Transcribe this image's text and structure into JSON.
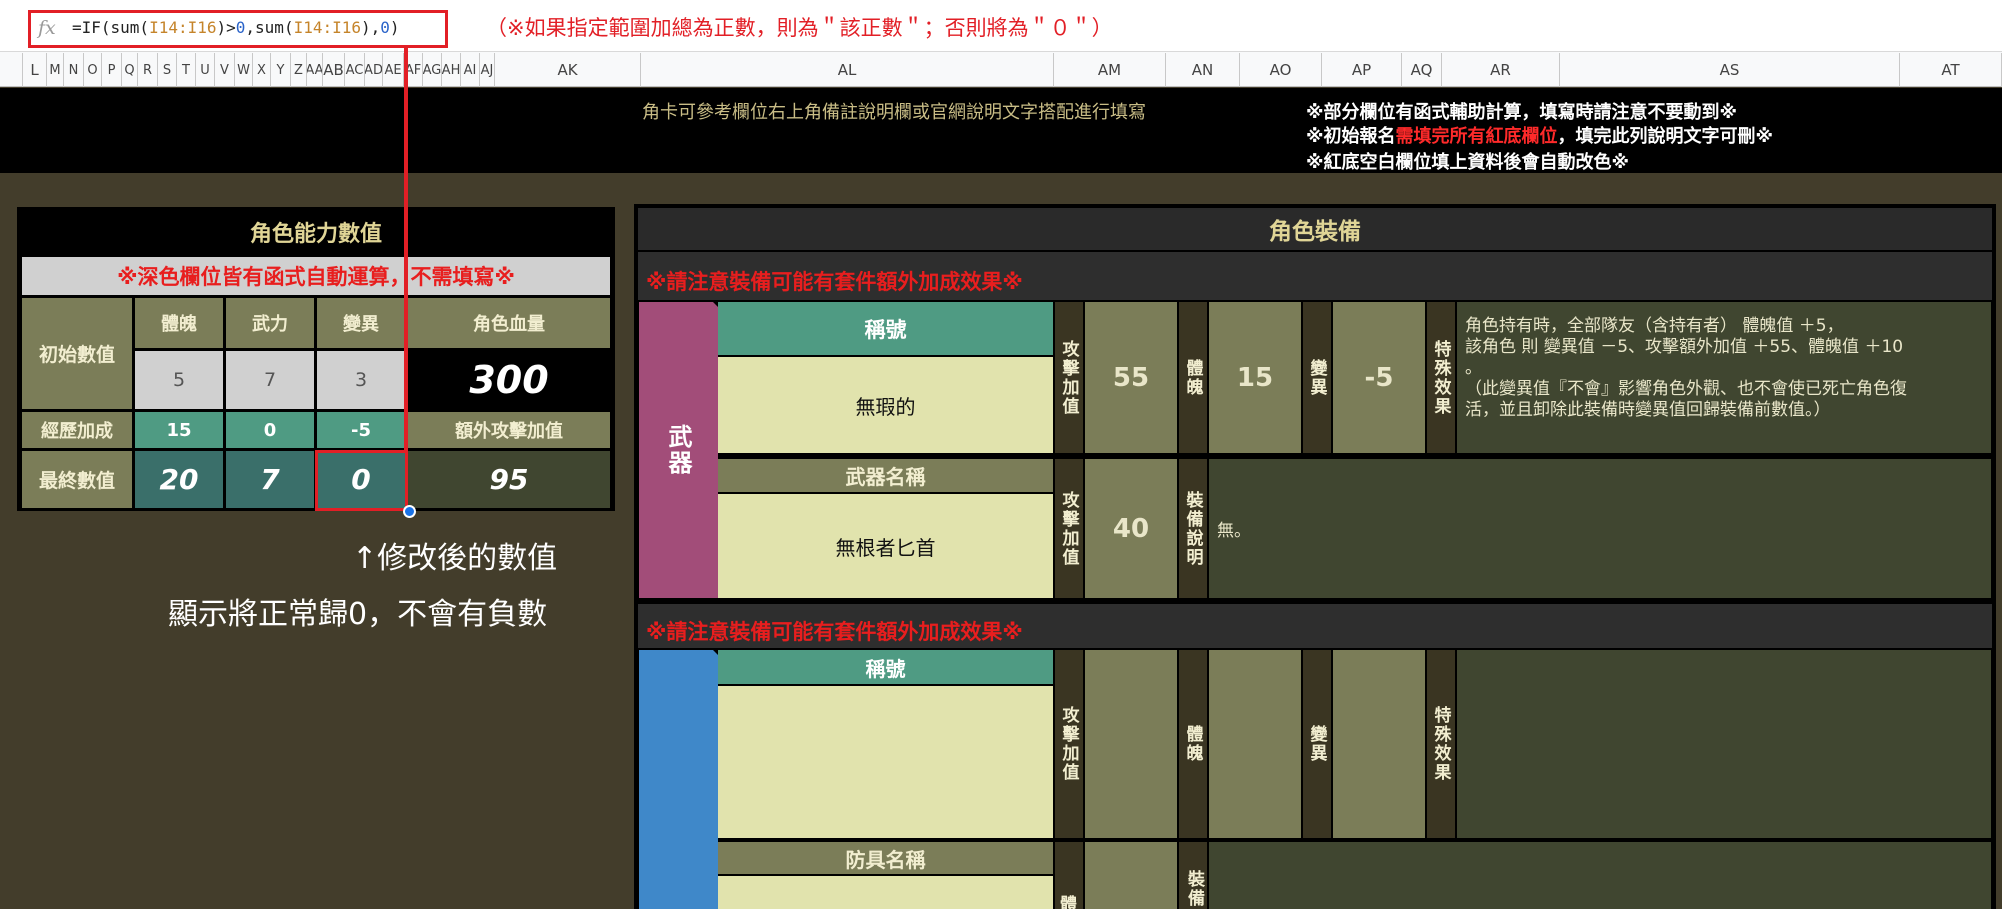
{
  "formula_bar": {
    "fx_label": "fx",
    "formula": {
      "p1": "=IF(sum(",
      "r1": "I14:I16",
      "p2": ")>",
      "z1": "0",
      "p3": ",sum(",
      "r2": "I14:I16",
      "p4": "),",
      "z2": "0",
      "p5": ")"
    },
    "note": "（※如果指定範圍加總為正數，則為＂該正數＂；否則將為＂０＂）"
  },
  "columns": [
    "L",
    "M",
    "N",
    "O",
    "P",
    "Q",
    "R",
    "S",
    "T",
    "U",
    "V",
    "W",
    "X",
    "Y",
    "Z",
    "AA",
    "AB",
    "AC",
    "AD",
    "AE",
    "AF",
    "AG",
    "AH",
    "AI",
    "AJ",
    "AK",
    "AL",
    "AM",
    "AN",
    "AO",
    "AP",
    "AQ",
    "AR",
    "AS",
    "AT"
  ],
  "banner": {
    "hint": "角卡可參考欄位右上角備註說明欄或官網說明文字搭配進行填寫",
    "line1": "※部分欄位有函式輔助計算，填寫時請注意不要動到※",
    "line2_a": "※初始報名",
    "line2_red": "需填完所有紅底欄位",
    "line2_b": "，填完此列說明文字可刪※",
    "line3": "※紅底空白欄位填上資料後會自動改色※"
  },
  "stats": {
    "title": "角色能力數值",
    "warning": "※深色欄位皆有函式自動運算，不需填寫※",
    "headers": [
      "體魄",
      "武力",
      "變異",
      "角色血量"
    ],
    "rows": [
      {
        "label": "初始數值",
        "values": [
          "5",
          "7",
          "3"
        ],
        "extra": "300"
      },
      {
        "label": "經歷加成",
        "values": [
          "15",
          "0",
          "-5"
        ],
        "extra": "額外攻擊加值"
      },
      {
        "label": "最終數值",
        "values": [
          "20",
          "7",
          "0"
        ],
        "extra": "95"
      }
    ]
  },
  "annotation": {
    "line1": "↑修改後的數值",
    "line2": "顯示將正常歸0，不會有負數"
  },
  "equipment": {
    "title": "角色裝備",
    "set_warning": "※請注意裝備可能有套件額外加成效果※",
    "weapon_section": {
      "side_label": "武器",
      "title_label": "稱號",
      "title_value": "無瑕的",
      "atk_label": "攻擊加值",
      "atk_value": "55",
      "body_label": "體魄",
      "body_value": "15",
      "mut_label": "變異",
      "mut_value": "-5",
      "special_label": "特殊效果",
      "special_text1": "角色持有時，全部隊友（含持有者） 體魄值 ＋5，",
      "special_text2": "該角色 則 變異值 －5、攻擊額外加值 ＋55、體魄值 ＋10",
      "special_text3": "。",
      "special_text4": "（此變異值『不會』影響角色外觀、也不會使已死亡角色復",
      "special_text5": "活，並且卸除此裝備時變異值回歸裝備前數值。）",
      "name_label": "武器名稱",
      "name_value": "無根者匕首",
      "name_atk_label": "攻擊加值",
      "name_atk_value": "40",
      "desc_label": "裝備說明",
      "desc_value": "無。"
    },
    "armor_section": {
      "title_label": "稱號",
      "atk_label": "攻擊加值",
      "body_label": "體魄",
      "mut_label": "變異",
      "special_label": "特殊效果",
      "name_label": "防具名稱",
      "name_body_label": "體",
      "desc_label": "裝備"
    }
  },
  "colors": {
    "background": "#433d2b",
    "teal": "#4f9b83",
    "olive": "#7b7d58",
    "dark_teal": "#3a6f6a",
    "cream": "#e1e3ad",
    "weapon_pink": "#a24d79",
    "armor_blue": "#3f88c9",
    "red": "#ff2020",
    "gold_text": "#e0d596"
  }
}
